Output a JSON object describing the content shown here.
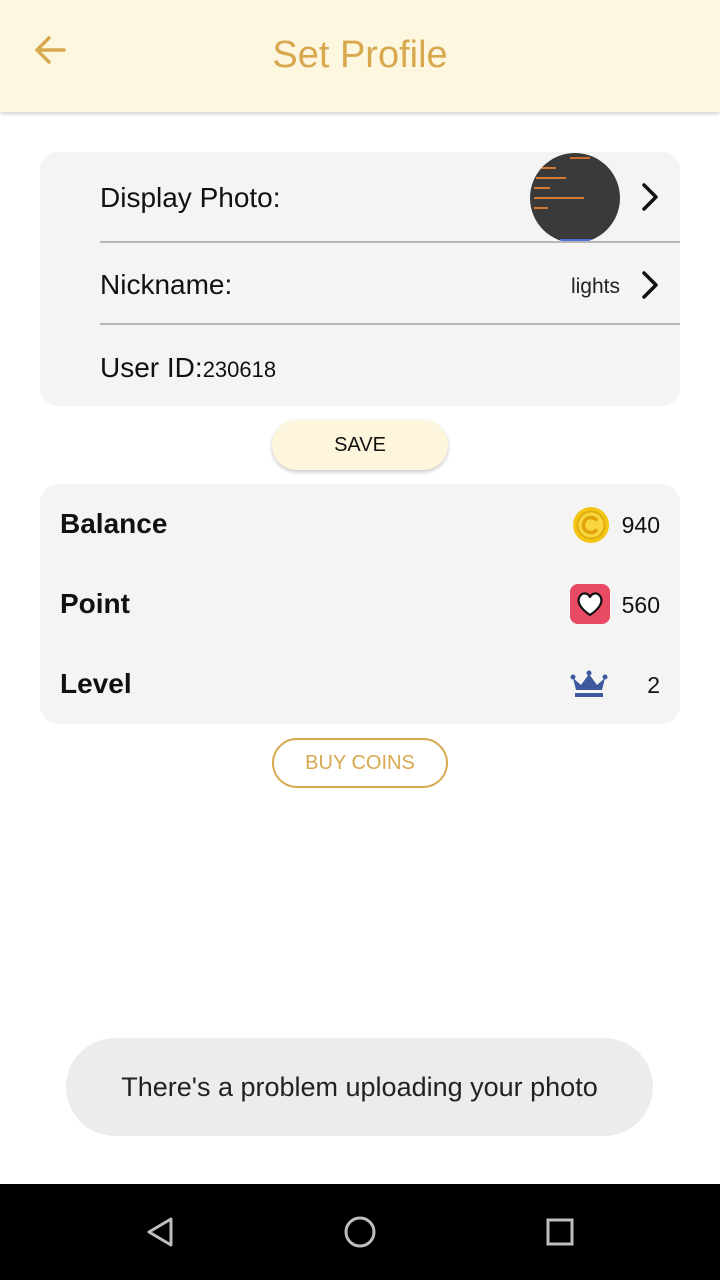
{
  "header": {
    "title": "Set Profile",
    "back_icon": "arrow-left-icon"
  },
  "profile": {
    "display_photo_label": "Display Photo:",
    "nickname_label": "Nickname:",
    "nickname_value": "lights",
    "user_id_label": "User ID:",
    "user_id_value": "230618"
  },
  "save_label": "SAVE",
  "stats": {
    "balance": {
      "label": "Balance",
      "value": "940",
      "icon": "coin-icon"
    },
    "point": {
      "label": "Point",
      "value": "560",
      "icon": "heart-icon"
    },
    "level": {
      "label": "Level",
      "value": "2",
      "icon": "crown-icon"
    }
  },
  "buy_coins_label": "BUY COINS",
  "toast_message": "There's a problem uploading your photo",
  "colors": {
    "accent": "#d8a84f",
    "header_bg": "#fef7df",
    "card_bg": "#f4f4f4",
    "crown": "#3d5a9e",
    "heart_bg": "#e84a63"
  },
  "navbar": {
    "back": "nav-back-icon",
    "home": "nav-home-icon",
    "recents": "nav-recents-icon"
  }
}
